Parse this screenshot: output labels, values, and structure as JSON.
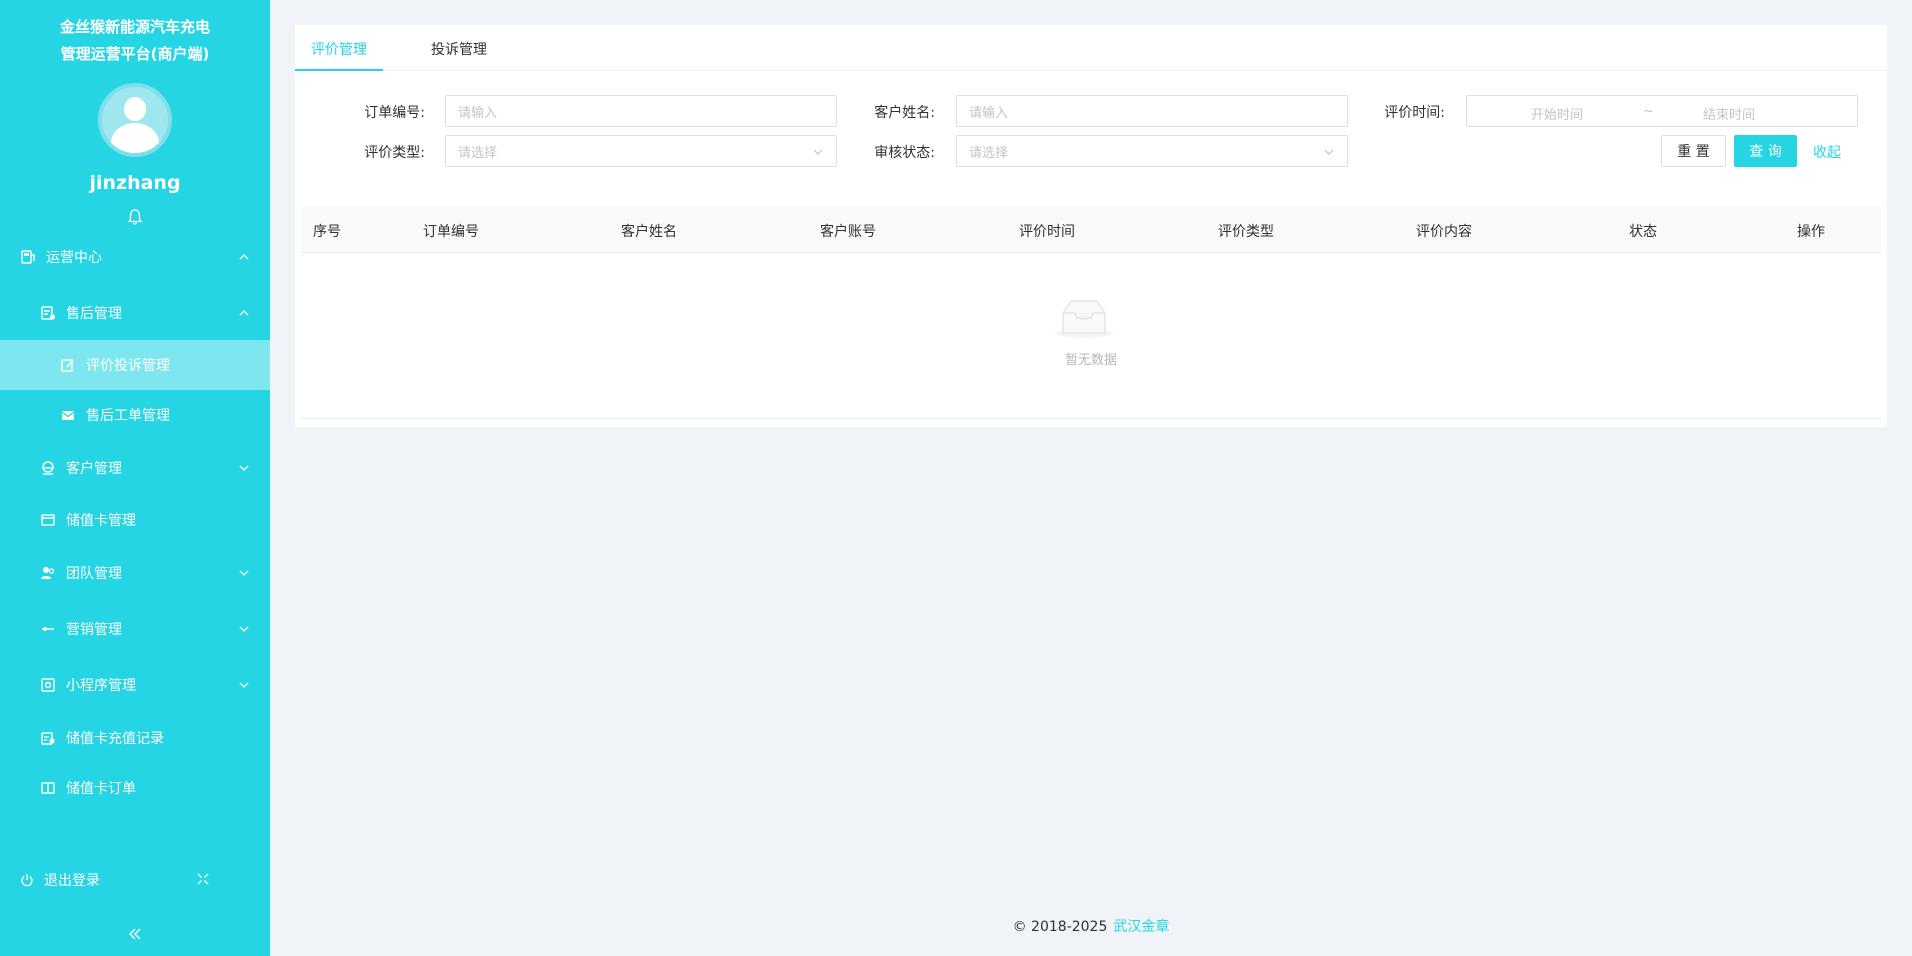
{
  "sidebar": {
    "brand_line1": "金丝猴新能源汽车充电",
    "brand_line2": "管理运营平台(商户端)",
    "username": "jinzhang",
    "menu": [
      {
        "label": "运营中心"
      },
      {
        "label": "售后管理"
      },
      {
        "label": "评价投诉管理"
      },
      {
        "label": "售后工单管理"
      },
      {
        "label": "客户管理"
      },
      {
        "label": "储值卡管理"
      },
      {
        "label": "团队管理"
      },
      {
        "label": "营销管理"
      },
      {
        "label": "小程序管理"
      },
      {
        "label": "储值卡充值记录"
      },
      {
        "label": "储值卡订单"
      }
    ],
    "logout_label": "退出登录"
  },
  "tabs": [
    {
      "label": "评价管理"
    },
    {
      "label": "投诉管理"
    }
  ],
  "filters": {
    "order_no_label": "订单编号:",
    "order_no_placeholder": "请输入",
    "customer_name_label": "客户姓名:",
    "customer_name_placeholder": "请输入",
    "review_time_label": "评价时间:",
    "start_placeholder": "开始时间",
    "range_sep": "~",
    "end_placeholder": "结束时间",
    "review_type_label": "评价类型:",
    "review_type_placeholder": "请选择",
    "audit_status_label": "审核状态:",
    "audit_status_placeholder": "请选择",
    "reset_label": "重 置",
    "query_label": "查 询",
    "collapse_label": "收起"
  },
  "table": {
    "columns": [
      "序号",
      "订单编号",
      "客户姓名",
      "客户账号",
      "评价时间",
      "评价类型",
      "评价内容",
      "状态",
      "操作"
    ],
    "empty_text": "暂无数据"
  },
  "footer": {
    "copyright": "© 2018-2025",
    "company": "武汉金章"
  },
  "colors": {
    "accent": "#25d5e4",
    "sidebar_bg": "#25d5e4",
    "active_item_bg": "#7ee6ef",
    "page_bg": "#f0f4f8"
  }
}
